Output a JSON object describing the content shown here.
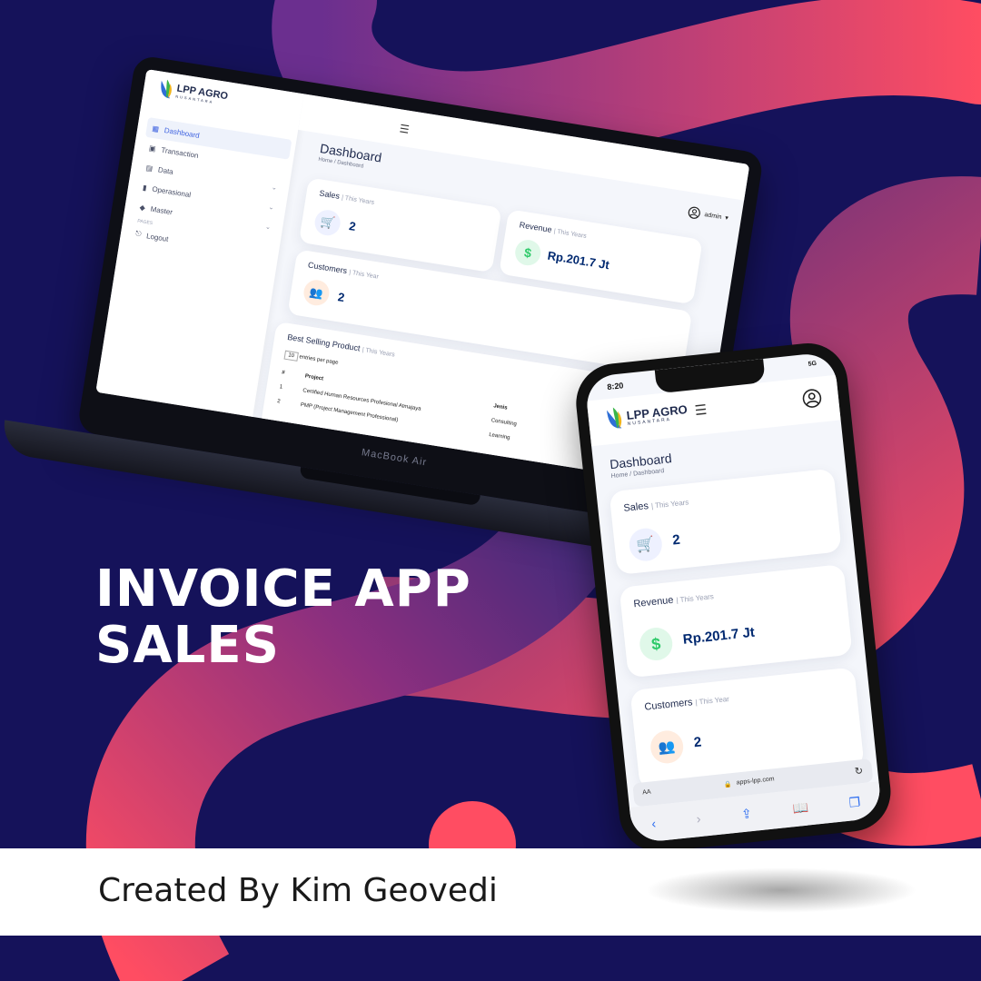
{
  "colors": {
    "background": "#15125a",
    "accent_pink": "#ff4d6d",
    "accent_purple": "#6b2f8f"
  },
  "headline": {
    "line1": "INVOICE APP",
    "line2": "SALES"
  },
  "footer": {
    "credit": "Created By Kim Geovedi"
  },
  "laptop": {
    "device_label": "MacBook Air",
    "logo": {
      "name": "LPP AGRO",
      "sub": "NUSANTARA"
    },
    "sidebar": {
      "items": [
        {
          "label": "Dashboard",
          "icon": "grid-icon"
        },
        {
          "label": "Transaction",
          "icon": "receipt-icon"
        },
        {
          "label": "Data",
          "icon": "database-icon"
        },
        {
          "label": "Operasional",
          "icon": "chart-icon"
        },
        {
          "label": "Master",
          "icon": "gem-icon"
        }
      ],
      "pages_heading": "PAGES",
      "logout": "Logout"
    },
    "user": "admin",
    "page_title": "Dashboard",
    "breadcrumb": {
      "home": "Home",
      "sep": "/",
      "current": "Dashboard"
    },
    "cards": {
      "sales": {
        "title": "Sales",
        "period": "| This Years",
        "value": "2"
      },
      "revenue": {
        "title": "Revenue",
        "period": "| This Years",
        "value": "Rp.201.7 Jt"
      },
      "customers": {
        "title": "Customers",
        "period": "| This Year",
        "value": "2"
      }
    },
    "table": {
      "title": "Best Selling Product",
      "period": "| This Years",
      "entries_value": "10",
      "entries_label": "entries per page",
      "headers": {
        "num": "#",
        "project": "Project",
        "jenis": "Jenis"
      },
      "rows": [
        {
          "num": "1",
          "project": "Certified Human Resources Profesional Atmajaya",
          "jenis": "Consulting"
        },
        {
          "num": "2",
          "project": "PMP (Project Management Professional)",
          "jenis": "Learning"
        }
      ]
    }
  },
  "phone": {
    "time": "8:20",
    "signal": "5G",
    "logo": {
      "name": "LPP AGRO",
      "sub": "NUSANTARA"
    },
    "page_title": "Dashboard",
    "breadcrumb": {
      "home": "Home",
      "sep": "/",
      "current": "Dashboard"
    },
    "cards": {
      "sales": {
        "title": "Sales",
        "period": "| This Years",
        "value": "2"
      },
      "revenue": {
        "title": "Revenue",
        "period": "| This Years",
        "value": "Rp.201.7 Jt"
      },
      "customers": {
        "title": "Customers",
        "period": "| This Year",
        "value": "2"
      }
    },
    "url_bar": {
      "text_size": "AA",
      "url": "apps-lpp.com"
    }
  }
}
